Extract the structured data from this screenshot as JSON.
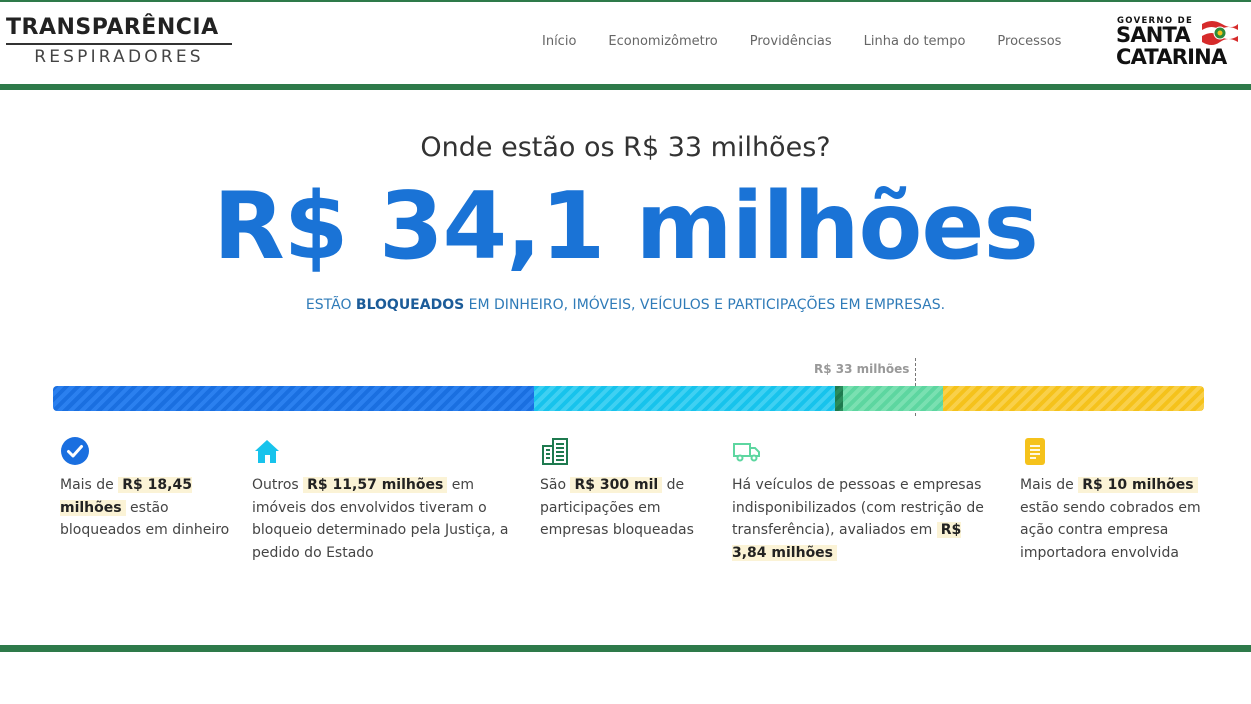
{
  "brand": {
    "title": "TRANSPARÊNCIA",
    "subtitle": "RESPIRADORES"
  },
  "nav": [
    {
      "label": "Início"
    },
    {
      "label": "Economizômetro"
    },
    {
      "label": "Providências"
    },
    {
      "label": "Linha do tempo"
    },
    {
      "label": "Processos"
    }
  ],
  "gov_logo": {
    "small": "GOVERNO DE",
    "line1": "SANTA",
    "line2": "CATARINA"
  },
  "hero": {
    "question": "Onde estão os R$ 33 milhões?",
    "amount": "R$ 34,1 milhões",
    "subtitle_pre": "ESTÃO ",
    "subtitle_bold": "BLOQUEADOS",
    "subtitle_post": " EM DINHEIRO, IMÓVEIS, VEÍCULOS E PARTICIPAÇÕES EM EMPRESAS."
  },
  "marker": {
    "label": "R$ 33 milhões",
    "value_millions": 33
  },
  "bar": {
    "total_millions": 34.1,
    "segments": [
      {
        "name": "dinheiro",
        "value_millions": 18.45,
        "color": "#1a6fe0",
        "stripe": "#2b80ef"
      },
      {
        "name": "imoveis",
        "value_millions": 11.57,
        "color": "#17c3ec",
        "stripe": "#3fd0f2"
      },
      {
        "name": "participacoes",
        "value_millions": 0.3,
        "color": "#1e7a4f",
        "stripe": "#2a8c5c"
      },
      {
        "name": "veiculos",
        "value_millions": 3.84,
        "color": "#5dd6a0",
        "stripe": "#7ae0b1"
      },
      {
        "name": "cobranca",
        "value_millions": 10,
        "color": "#f5c21b",
        "stripe": "#f9d04a"
      }
    ]
  },
  "items": [
    {
      "icon": "check-circle-icon",
      "color": "#1a6fe0",
      "parts": [
        {
          "t": "Mais de "
        },
        {
          "b": "R$ 18,45 milhões"
        },
        {
          "t": " estão bloqueados em dinheiro"
        }
      ]
    },
    {
      "icon": "house-icon",
      "color": "#17c3ec",
      "parts": [
        {
          "t": "Outros "
        },
        {
          "b": "R$ 11,57 milhões"
        },
        {
          "t": " em imóveis dos envolvidos tiveram o bloqueio determinado pela Justiça, a pedido do Estado"
        }
      ]
    },
    {
      "icon": "building-icon",
      "color": "#1e7a4f",
      "parts": [
        {
          "t": "São "
        },
        {
          "b": "R$ 300 mil"
        },
        {
          "t": " de participações em empresas bloqueadas"
        }
      ]
    },
    {
      "icon": "truck-icon",
      "color": "#5dd6a0",
      "parts": [
        {
          "t": "Há veículos de pessoas e empresas indisponibilizados (com restrição de transferência), avaliados em "
        },
        {
          "b": "R$ 3,84 milhões"
        }
      ]
    },
    {
      "icon": "document-icon",
      "color": "#f5c21b",
      "parts": [
        {
          "t": "Mais de "
        },
        {
          "b": "R$ 10 milhões"
        },
        {
          "t": " estão sendo cobrados em ação contra empresa importadora envolvida"
        }
      ]
    }
  ]
}
